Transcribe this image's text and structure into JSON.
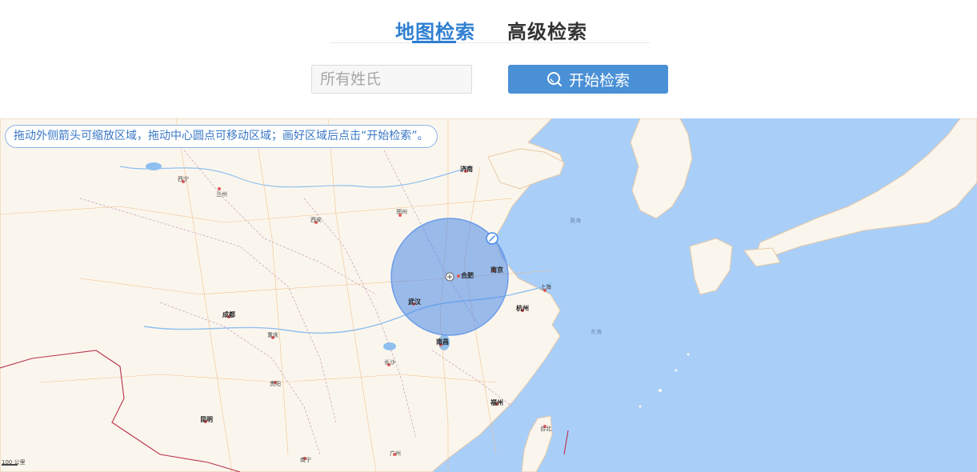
{
  "tabs": [
    {
      "label": "地图检索",
      "active": true
    },
    {
      "label": "高级检索",
      "active": false
    }
  ],
  "search": {
    "placeholder": "所有姓氏",
    "value": "",
    "button_label": "开始检索"
  },
  "map": {
    "hint": "拖动外侧箭头可缩放区域，拖动中心圆点可移动区域；画好区域后点击“开始检索”。",
    "cities": [
      {
        "name": "济南",
        "major": true
      },
      {
        "name": "西宁",
        "major": false
      },
      {
        "name": "兰州",
        "major": false
      },
      {
        "name": "西安",
        "major": false
      },
      {
        "name": "郑州",
        "major": false
      },
      {
        "name": "南京",
        "major": true
      },
      {
        "name": "合肥",
        "major": true
      },
      {
        "name": "武汉",
        "major": true
      },
      {
        "name": "上海",
        "major": false
      },
      {
        "name": "杭州",
        "major": true
      },
      {
        "name": "南昌",
        "major": true
      },
      {
        "name": "长沙",
        "major": false
      },
      {
        "name": "成都",
        "major": true
      },
      {
        "name": "重庆",
        "major": false
      },
      {
        "name": "贵阳",
        "major": false
      },
      {
        "name": "昆明",
        "major": true
      },
      {
        "name": "南宁",
        "major": false
      },
      {
        "name": "广州",
        "major": false
      },
      {
        "name": "福州",
        "major": true
      },
      {
        "name": "台北",
        "major": false
      },
      {
        "name": "东海",
        "major": false
      },
      {
        "name": "黄海",
        "major": false
      }
    ],
    "scale_label": "100 公里"
  },
  "colors": {
    "accent": "#2f7fd1",
    "button": "#4a90d6",
    "sea": "#a9cff9",
    "land": "#fbf6ed",
    "circle": "#4a88e8"
  }
}
